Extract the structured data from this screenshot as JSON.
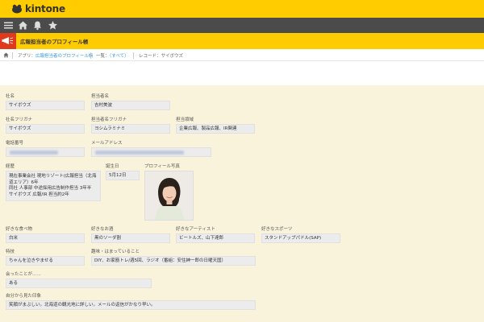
{
  "header": {
    "brand": "kintone"
  },
  "navbar": {
    "icons": [
      "menu-icon",
      "home-icon",
      "bell-icon",
      "star-icon"
    ]
  },
  "app": {
    "title": "広報担当者のプロフィール帳",
    "accent": "#e03a1e",
    "brand_color": "#ffcc00"
  },
  "breadcrumb": {
    "app_prefix": "アプリ：",
    "app_name": "広報担当者のプロフィール帳",
    "list_prefix": "一覧：",
    "list_name": "（すべて）",
    "record": "レコード：サイボウズ"
  },
  "fields": {
    "company": {
      "label": "社名",
      "value": "サイボウズ"
    },
    "person": {
      "label": "担当者名",
      "value": "吉村美波"
    },
    "company_kana": {
      "label": "社名フリガナ",
      "value": "サイボウズ"
    },
    "person_kana": {
      "label": "担当者名フリガナ",
      "value": "ヨシムラミナミ"
    },
    "area": {
      "label": "担当領域",
      "value": "企業広報、製品広報、IR関連"
    },
    "phone": {
      "label": "電話番号",
      "value": ""
    },
    "email": {
      "label": "メールアドレス",
      "value": ""
    },
    "career": {
      "label": "経歴",
      "lines": [
        "現在事業会社 現地リゾート(広報担当（北海",
        "道エリア）6年",
        "同社 人事部 中途採用広告制作担当 3年半",
        "サイボウズ 広報/IR 担当約2年"
      ]
    },
    "birthday": {
      "label": "誕生日",
      "value": "5月12日"
    },
    "photo": {
      "label": "プロフィール写真"
    },
    "fav_food": {
      "label": "好きな食べ物",
      "value": "白米"
    },
    "fav_drink": {
      "label": "好きなお酒",
      "value": "黒のソーダ割"
    },
    "fav_artist": {
      "label": "好きなアーティスト",
      "value": "ビートルズ、山下達郎"
    },
    "fav_sport": {
      "label": "好きなスポーツ",
      "value": "スタンドアップパドル(SAP)"
    },
    "skill": {
      "label": "特技",
      "value": "ちゃんを泣きやませる"
    },
    "hobby": {
      "label": "趣味・はまっていること",
      "value": "DIY、お家筋トレ/週5回、ラジオ（番組：安住紳一郎の日曜天国）"
    },
    "met": {
      "label": "会ったことが……",
      "value": "ある"
    },
    "impression": {
      "label": "自分から見た印象",
      "value": "笑顔がまぶしい。北海道の観光地に詳しい。メールの返信がかなり早い。"
    }
  }
}
